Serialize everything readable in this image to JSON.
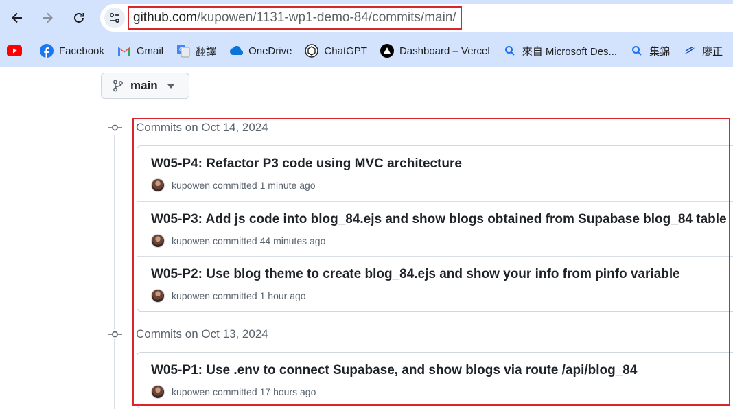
{
  "browser": {
    "url_host": "github.com",
    "url_path": "/kupowen/1131-wp1-demo-84/commits/main/",
    "bookmarks": [
      {
        "label": "",
        "icon": "youtube-icon"
      },
      {
        "label": "Facebook",
        "icon": "facebook-icon"
      },
      {
        "label": "Gmail",
        "icon": "gmail-icon"
      },
      {
        "label": "翻譯",
        "icon": "google-translate-icon"
      },
      {
        "label": "OneDrive",
        "icon": "onedrive-icon"
      },
      {
        "label": "ChatGPT",
        "icon": "chatgpt-icon"
      },
      {
        "label": "Dashboard – Vercel",
        "icon": "vercel-icon"
      },
      {
        "label": "來自 Microsoft Des...",
        "icon": "search-icon"
      },
      {
        "label": "集錦",
        "icon": "search-icon"
      },
      {
        "label": "廖正",
        "icon": "bookmark-icon"
      }
    ]
  },
  "branch": {
    "name": "main"
  },
  "commit_groups": [
    {
      "header": "Commits on Oct 14, 2024",
      "commits": [
        {
          "title": "W05-P4: Refactor P3 code using MVC architecture",
          "author": "kupowen",
          "verb": "committed",
          "time": "1 minute ago"
        },
        {
          "title": "W05-P3: Add js code into blog_84.ejs and show blogs obtained from Supabase blog_84 table",
          "author": "kupowen",
          "verb": "committed",
          "time": "44 minutes ago"
        },
        {
          "title": "W05-P2: Use blog theme to create blog_84.ejs and show your info from pinfo variable",
          "author": "kupowen",
          "verb": "committed",
          "time": "1 hour ago"
        }
      ]
    },
    {
      "header": "Commits on Oct 13, 2024",
      "commits": [
        {
          "title": "W05-P1: Use .env to connect Supabase, and show blogs via route /api/blog_84",
          "author": "kupowen",
          "verb": "committed",
          "time": "17 hours ago"
        }
      ]
    }
  ],
  "colors": {
    "chrome_bg": "#d3e3fd",
    "highlight_red": "#d9262c",
    "text_primary": "#1f2328",
    "text_muted": "#59636e"
  }
}
